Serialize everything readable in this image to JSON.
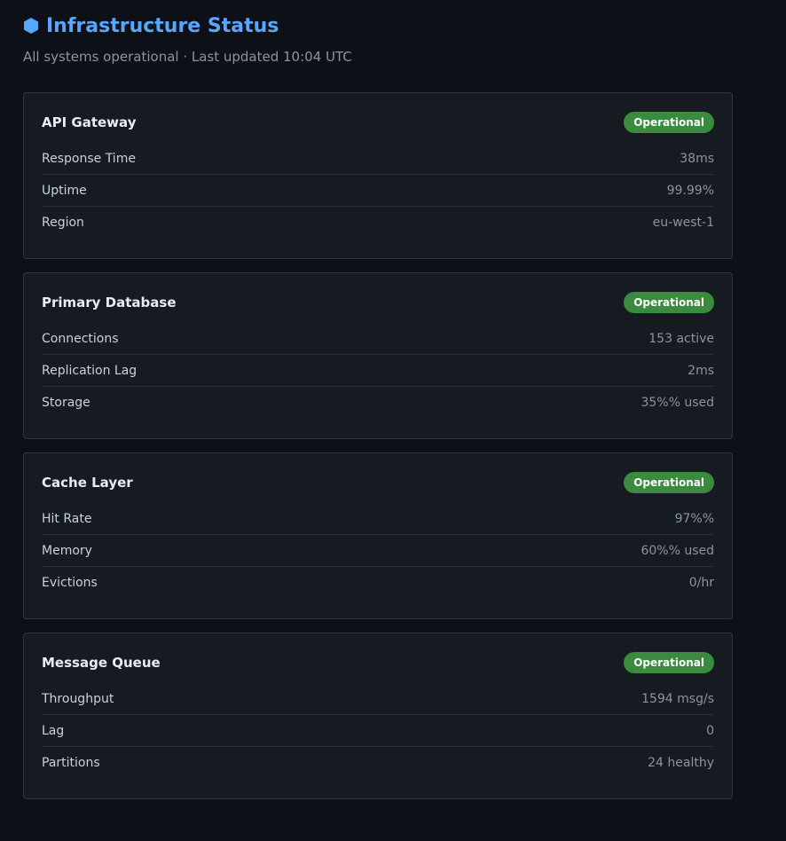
{
  "header": {
    "title": "Infrastructure Status",
    "icon": "hexagon-icon",
    "accent_color": "#58a6ff",
    "subtitle": "All systems operational · Last updated 10:04 UTC"
  },
  "services": [
    {
      "name": "API Gateway",
      "status": "Operational",
      "status_color": "#3a8a40",
      "metrics": [
        {
          "label": "Response Time",
          "value": "38ms"
        },
        {
          "label": "Uptime",
          "value": "99.99%"
        },
        {
          "label": "Region",
          "value": "eu-west-1"
        }
      ]
    },
    {
      "name": "Primary Database",
      "status": "Operational",
      "status_color": "#3a8a40",
      "metrics": [
        {
          "label": "Connections",
          "value": "153 active"
        },
        {
          "label": "Replication Lag",
          "value": "2ms"
        },
        {
          "label": "Storage",
          "value": "35%% used"
        }
      ]
    },
    {
      "name": "Cache Layer",
      "status": "Operational",
      "status_color": "#3a8a40",
      "metrics": [
        {
          "label": "Hit Rate",
          "value": "97%%"
        },
        {
          "label": "Memory",
          "value": "60%% used"
        },
        {
          "label": "Evictions",
          "value": "0/hr"
        }
      ]
    },
    {
      "name": "Message Queue",
      "status": "Operational",
      "status_color": "#3a8a40",
      "metrics": [
        {
          "label": "Throughput",
          "value": "1594 msg/s"
        },
        {
          "label": "Lag",
          "value": "0"
        },
        {
          "label": "Partitions",
          "value": "24 healthy"
        }
      ]
    }
  ]
}
